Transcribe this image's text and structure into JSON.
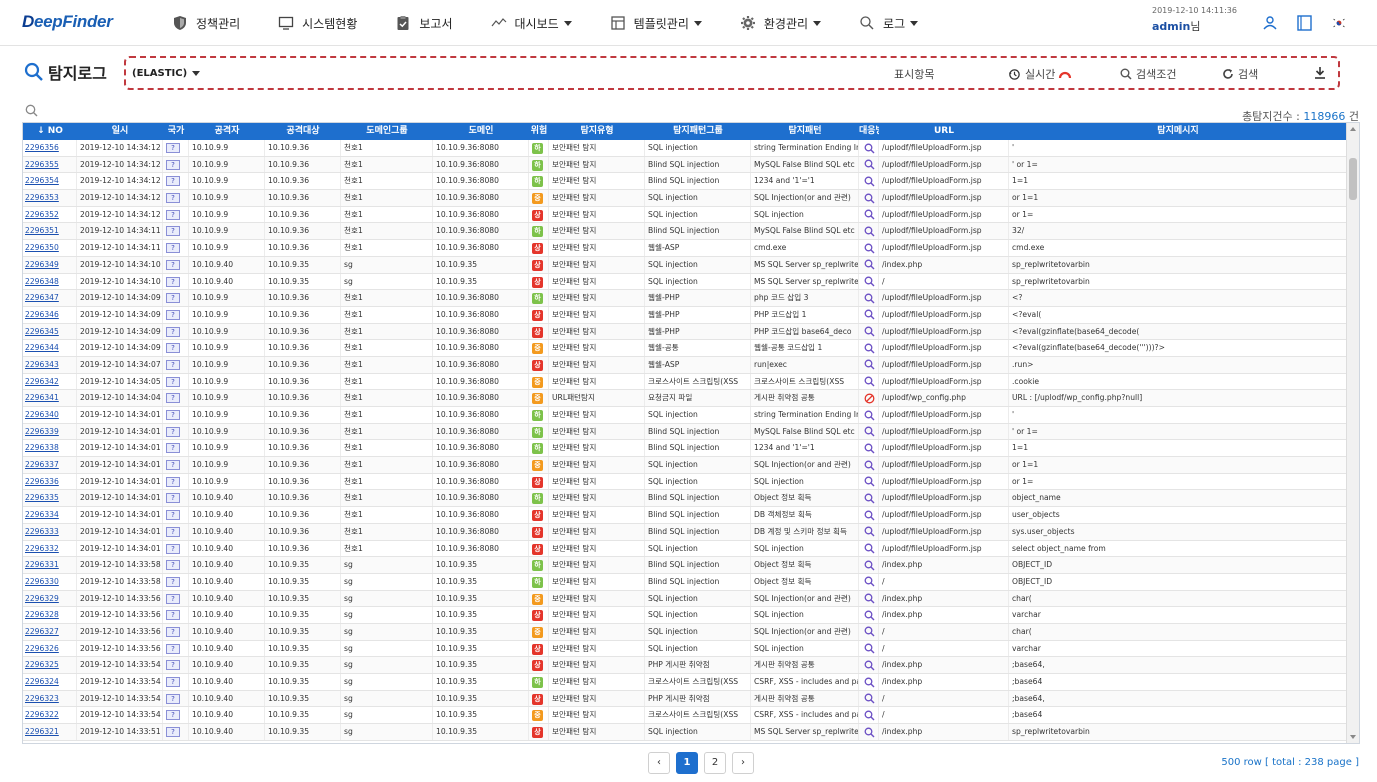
{
  "app": {
    "logo_prefix": "D",
    "logo_rest": "eepFinder",
    "brand_color": "#1e6fce"
  },
  "nav": [
    {
      "label": "정책관리",
      "icon": "shield-icon",
      "caret": false
    },
    {
      "label": "시스템현황",
      "icon": "monitor-icon",
      "caret": false
    },
    {
      "label": "보고서",
      "icon": "clipboard-check-icon",
      "caret": false
    },
    {
      "label": "대시보드",
      "icon": "trend-line-icon",
      "caret": true
    },
    {
      "label": "템플릿관리",
      "icon": "template-icon",
      "caret": true
    },
    {
      "label": "환경관리",
      "icon": "gear-icon",
      "caret": true
    },
    {
      "label": "로그",
      "icon": "search-icon",
      "caret": true
    }
  ],
  "user": {
    "timestamp": "2019-12-10 14:11:36",
    "name": "admin",
    "suffix": "님"
  },
  "page": {
    "title": "탐지로그",
    "source": "(ELASTIC)"
  },
  "toolbar": {
    "display_items": "표시항목",
    "realtime": "실시간",
    "search_conditions": "검색조건",
    "search": "검색"
  },
  "summary": {
    "label": "총탐지건수 : ",
    "count": "118966",
    "unit": " 건"
  },
  "table": {
    "columns": [
      {
        "label": "NO",
        "w": 54
      },
      {
        "label": "일시",
        "w": 86
      },
      {
        "label": "국가",
        "w": 26
      },
      {
        "label": "공격자",
        "w": 76
      },
      {
        "label": "공격대상",
        "w": 76
      },
      {
        "label": "도메인그룹",
        "w": 92
      },
      {
        "label": "도메인",
        "w": 96
      },
      {
        "label": "위험",
        "w": 20
      },
      {
        "label": "탐지유형",
        "w": 96
      },
      {
        "label": "탐지패턴그룹",
        "w": 106
      },
      {
        "label": "탐지패턴",
        "w": 108
      },
      {
        "label": "대응방법",
        "w": 20
      },
      {
        "label": "URL",
        "w": 130
      },
      {
        "label": "탐지메시지",
        "w": 338
      }
    ],
    "rows": [
      [
        "2296356",
        "2019-12-10 14:34:12",
        "?",
        "10.10.9.9",
        "10.10.9.36",
        "천호1",
        "10.10.9.36:8080",
        "하",
        "l",
        "보안패턴 탐지",
        "SQL injection",
        "string Termination Ending In",
        "q",
        "/uplodf/fileUploadForm.jsp",
        "'"
      ],
      [
        "2296355",
        "2019-12-10 14:34:12",
        "?",
        "10.10.9.9",
        "10.10.9.36",
        "천호1",
        "10.10.9.36:8080",
        "하",
        "l",
        "보안패턴 탐지",
        "Blind SQL injection",
        "MySQL False Blind SQL etc",
        "q",
        "/uplodf/fileUploadForm.jsp",
        "' or 1="
      ],
      [
        "2296354",
        "2019-12-10 14:34:12",
        "?",
        "10.10.9.9",
        "10.10.9.36",
        "천호1",
        "10.10.9.36:8080",
        "하",
        "l",
        "보안패턴 탐지",
        "Blind SQL injection",
        "1234 and '1'='1",
        "q",
        "/uplodf/fileUploadForm.jsp",
        "1=1"
      ],
      [
        "2296353",
        "2019-12-10 14:34:12",
        "?",
        "10.10.9.9",
        "10.10.9.36",
        "천호1",
        "10.10.9.36:8080",
        "중",
        "m",
        "보안패턴 탐지",
        "SQL injection",
        "SQL Injection(or and 관련)",
        "q",
        "/uplodf/fileUploadForm.jsp",
        "or 1=1"
      ],
      [
        "2296352",
        "2019-12-10 14:34:12",
        "?",
        "10.10.9.9",
        "10.10.9.36",
        "천호1",
        "10.10.9.36:8080",
        "상",
        "h",
        "보안패턴 탐지",
        "SQL injection",
        "SQL injection",
        "q",
        "/uplodf/fileUploadForm.jsp",
        "or 1="
      ],
      [
        "2296351",
        "2019-12-10 14:34:11",
        "?",
        "10.10.9.9",
        "10.10.9.36",
        "천호1",
        "10.10.9.36:8080",
        "하",
        "l",
        "보안패턴 탐지",
        "Blind SQL injection",
        "MySQL False Blind SQL etc",
        "q",
        "/uplodf/fileUploadForm.jsp",
        "32/"
      ],
      [
        "2296350",
        "2019-12-10 14:34:11",
        "?",
        "10.10.9.9",
        "10.10.9.36",
        "천호1",
        "10.10.9.36:8080",
        "상",
        "h",
        "보안패턴 탐지",
        "웹쉘-ASP",
        "cmd.exe",
        "q",
        "/uplodf/fileUploadForm.jsp",
        "cmd.exe"
      ],
      [
        "2296349",
        "2019-12-10 14:34:10",
        "?",
        "10.10.9.40",
        "10.10.9.35",
        "sg",
        "10.10.9.35",
        "상",
        "h",
        "보안패턴 탐지",
        "SQL injection",
        "MS SQL Server sp_replwritet",
        "q",
        "/index.php",
        "sp_replwritetovarbin"
      ],
      [
        "2296348",
        "2019-12-10 14:34:10",
        "?",
        "10.10.9.40",
        "10.10.9.35",
        "sg",
        "10.10.9.35",
        "상",
        "h",
        "보안패턴 탐지",
        "SQL injection",
        "MS SQL Server sp_replwritet",
        "q",
        "/",
        "sp_replwritetovarbin"
      ],
      [
        "2296347",
        "2019-12-10 14:34:09",
        "?",
        "10.10.9.9",
        "10.10.9.36",
        "천호1",
        "10.10.9.36:8080",
        "하",
        "l",
        "보안패턴 탐지",
        "웹쉘-PHP",
        "php 코드 삽입 3",
        "q",
        "/uplodf/fileUploadForm.jsp",
        "<?"
      ],
      [
        "2296346",
        "2019-12-10 14:34:09",
        "?",
        "10.10.9.9",
        "10.10.9.36",
        "천호1",
        "10.10.9.36:8080",
        "상",
        "h",
        "보안패턴 탐지",
        "웹쉘-PHP",
        "PHP 코드삽입 1",
        "q",
        "/uplodf/fileUploadForm.jsp",
        "<?eval("
      ],
      [
        "2296345",
        "2019-12-10 14:34:09",
        "?",
        "10.10.9.9",
        "10.10.9.36",
        "천호1",
        "10.10.9.36:8080",
        "상",
        "h",
        "보안패턴 탐지",
        "웹쉘-PHP",
        "PHP 코드삽입 base64_deco",
        "q",
        "/uplodf/fileUploadForm.jsp",
        "<?eval(gzinflate(base64_decode("
      ],
      [
        "2296344",
        "2019-12-10 14:34:09",
        "?",
        "10.10.9.9",
        "10.10.9.36",
        "천호1",
        "10.10.9.36:8080",
        "중",
        "m",
        "보안패턴 탐지",
        "웹쉘-공통",
        "웹쉘-공통 코드삽입 1",
        "q",
        "/uplodf/fileUploadForm.jsp",
        "<?eval(gzinflate(base64_decode(''')))?>"
      ],
      [
        "2296343",
        "2019-12-10 14:34:07",
        "?",
        "10.10.9.9",
        "10.10.9.36",
        "천호1",
        "10.10.9.36:8080",
        "상",
        "h",
        "보안패턴 탐지",
        "웹쉘-ASP",
        "run|exec",
        "q",
        "/uplodf/fileUploadForm.jsp",
        ".run>"
      ],
      [
        "2296342",
        "2019-12-10 14:34:05",
        "?",
        "10.10.9.9",
        "10.10.9.36",
        "천호1",
        "10.10.9.36:8080",
        "중",
        "m",
        "보안패턴 탐지",
        "크로스사이트 스크립팅(XSS",
        "크로스사이트 스크립팅(XSS",
        "q",
        "/uplodf/fileUploadForm.jsp",
        ".cookie"
      ],
      [
        "2296341",
        "2019-12-10 14:34:04",
        "?",
        "10.10.9.9",
        "10.10.9.36",
        "천호1",
        "10.10.9.36:8080",
        "중",
        "m",
        "URL패턴탐지",
        "요청금지 파일",
        "게시판 취약점 공통",
        "x",
        "/uplodf/wp_config.php",
        "URL : [/uplodf/wp_config.php?null]"
      ],
      [
        "2296340",
        "2019-12-10 14:34:01",
        "?",
        "10.10.9.9",
        "10.10.9.36",
        "천호1",
        "10.10.9.36:8080",
        "하",
        "l",
        "보안패턴 탐지",
        "SQL injection",
        "string Termination Ending In",
        "q",
        "/uplodf/fileUploadForm.jsp",
        "'"
      ],
      [
        "2296339",
        "2019-12-10 14:34:01",
        "?",
        "10.10.9.9",
        "10.10.9.36",
        "천호1",
        "10.10.9.36:8080",
        "하",
        "l",
        "보안패턴 탐지",
        "Blind SQL injection",
        "MySQL False Blind SQL etc",
        "q",
        "/uplodf/fileUploadForm.jsp",
        "' or 1="
      ],
      [
        "2296338",
        "2019-12-10 14:34:01",
        "?",
        "10.10.9.9",
        "10.10.9.36",
        "천호1",
        "10.10.9.36:8080",
        "하",
        "l",
        "보안패턴 탐지",
        "Blind SQL injection",
        "1234 and '1'='1",
        "q",
        "/uplodf/fileUploadForm.jsp",
        "1=1"
      ],
      [
        "2296337",
        "2019-12-10 14:34:01",
        "?",
        "10.10.9.9",
        "10.10.9.36",
        "천호1",
        "10.10.9.36:8080",
        "중",
        "m",
        "보안패턴 탐지",
        "SQL injection",
        "SQL Injection(or and 관련)",
        "q",
        "/uplodf/fileUploadForm.jsp",
        "or 1=1"
      ],
      [
        "2296336",
        "2019-12-10 14:34:01",
        "?",
        "10.10.9.9",
        "10.10.9.36",
        "천호1",
        "10.10.9.36:8080",
        "상",
        "h",
        "보안패턴 탐지",
        "SQL injection",
        "SQL injection",
        "q",
        "/uplodf/fileUploadForm.jsp",
        "or 1="
      ],
      [
        "2296335",
        "2019-12-10 14:34:01",
        "?",
        "10.10.9.40",
        "10.10.9.36",
        "천호1",
        "10.10.9.36:8080",
        "하",
        "l",
        "보안패턴 탐지",
        "Blind SQL injection",
        "Object 정보 획득",
        "q",
        "/uplodf/fileUploadForm.jsp",
        "object_name"
      ],
      [
        "2296334",
        "2019-12-10 14:34:01",
        "?",
        "10.10.9.40",
        "10.10.9.36",
        "천호1",
        "10.10.9.36:8080",
        "상",
        "h",
        "보안패턴 탐지",
        "Blind SQL injection",
        "DB 객체정보 획득",
        "q",
        "/uplodf/fileUploadForm.jsp",
        "user_objects"
      ],
      [
        "2296333",
        "2019-12-10 14:34:01",
        "?",
        "10.10.9.40",
        "10.10.9.36",
        "천호1",
        "10.10.9.36:8080",
        "상",
        "h",
        "보안패턴 탐지",
        "Blind SQL injection",
        "DB 계정 및 스키마 정보 획득",
        "q",
        "/uplodf/fileUploadForm.jsp",
        "sys.user_objects"
      ],
      [
        "2296332",
        "2019-12-10 14:34:01",
        "?",
        "10.10.9.40",
        "10.10.9.36",
        "천호1",
        "10.10.9.36:8080",
        "상",
        "h",
        "보안패턴 탐지",
        "SQL injection",
        "SQL injection",
        "q",
        "/uplodf/fileUploadForm.jsp",
        "select object_name from"
      ],
      [
        "2296331",
        "2019-12-10 14:33:58",
        "?",
        "10.10.9.40",
        "10.10.9.35",
        "sg",
        "10.10.9.35",
        "하",
        "l",
        "보안패턴 탐지",
        "Blind SQL injection",
        "Object 정보 획득",
        "q",
        "/index.php",
        "OBJECT_ID"
      ],
      [
        "2296330",
        "2019-12-10 14:33:58",
        "?",
        "10.10.9.40",
        "10.10.9.35",
        "sg",
        "10.10.9.35",
        "하",
        "l",
        "보안패턴 탐지",
        "Blind SQL injection",
        "Object 정보 획득",
        "q",
        "/",
        "OBJECT_ID"
      ],
      [
        "2296329",
        "2019-12-10 14:33:56",
        "?",
        "10.10.9.40",
        "10.10.9.35",
        "sg",
        "10.10.9.35",
        "중",
        "m",
        "보안패턴 탐지",
        "SQL injection",
        "SQL Injection(or and 관련)",
        "q",
        "/index.php",
        "char("
      ],
      [
        "2296328",
        "2019-12-10 14:33:56",
        "?",
        "10.10.9.40",
        "10.10.9.35",
        "sg",
        "10.10.9.35",
        "상",
        "h",
        "보안패턴 탐지",
        "SQL injection",
        "SQL injection",
        "q",
        "/index.php",
        "varchar"
      ],
      [
        "2296327",
        "2019-12-10 14:33:56",
        "?",
        "10.10.9.40",
        "10.10.9.35",
        "sg",
        "10.10.9.35",
        "중",
        "m",
        "보안패턴 탐지",
        "SQL injection",
        "SQL Injection(or and 관련)",
        "q",
        "/",
        "char("
      ],
      [
        "2296326",
        "2019-12-10 14:33:56",
        "?",
        "10.10.9.40",
        "10.10.9.35",
        "sg",
        "10.10.9.35",
        "상",
        "h",
        "보안패턴 탐지",
        "SQL injection",
        "SQL injection",
        "q",
        "/",
        "varchar"
      ],
      [
        "2296325",
        "2019-12-10 14:33:54",
        "?",
        "10.10.9.40",
        "10.10.9.35",
        "sg",
        "10.10.9.35",
        "상",
        "h",
        "보안패턴 탐지",
        "PHP 게시판 취약점",
        "게시판 취약점 공통",
        "q",
        "/index.php",
        ";base64,"
      ],
      [
        "2296324",
        "2019-12-10 14:33:54",
        "?",
        "10.10.9.40",
        "10.10.9.35",
        "sg",
        "10.10.9.35",
        "하",
        "l",
        "보안패턴 탐지",
        "크로스사이트 스크립팅(XSS",
        "CSRF, XSS - includes and pa",
        "q",
        "/index.php",
        ";base64"
      ],
      [
        "2296323",
        "2019-12-10 14:33:54",
        "?",
        "10.10.9.40",
        "10.10.9.35",
        "sg",
        "10.10.9.35",
        "상",
        "h",
        "보안패턴 탐지",
        "PHP 게시판 취약점",
        "게시판 취약점 공통",
        "q",
        "/",
        ";base64,"
      ],
      [
        "2296322",
        "2019-12-10 14:33:54",
        "?",
        "10.10.9.40",
        "10.10.9.35",
        "sg",
        "10.10.9.35",
        "중",
        "m",
        "보안패턴 탐지",
        "크로스사이트 스크립팅(XSS",
        "CSRF, XSS - includes and pa",
        "q",
        "/",
        ";base64"
      ],
      [
        "2296321",
        "2019-12-10 14:33:51",
        "?",
        "10.10.9.40",
        "10.10.9.35",
        "sg",
        "10.10.9.35",
        "상",
        "h",
        "보안패턴 탐지",
        "SQL injection",
        "MS SQL Server sp_replwritet",
        "q",
        "/index.php",
        "sp_replwritetovarbin"
      ]
    ]
  },
  "pagination": {
    "pages": [
      "1",
      "2"
    ],
    "current": "1"
  },
  "rowinfo": "500 row [ total : 238 page ]"
}
